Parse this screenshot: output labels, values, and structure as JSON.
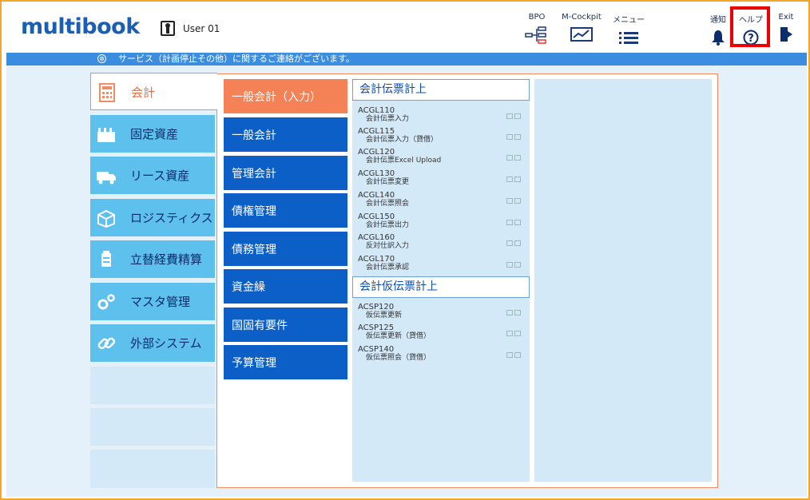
{
  "header": {
    "logo": "multibook",
    "user": "User 01",
    "nav": {
      "bpo": "BPO",
      "mcockpit": "M-Cockpit",
      "menu": "メニュー",
      "notify": "通知",
      "help": "ヘルプ",
      "exit": "Exit"
    }
  },
  "notice": {
    "icon": "⊗",
    "text": "サービス（計画停止その他）に関するご連絡がございます。"
  },
  "categories": [
    {
      "label": "会計",
      "icon": "calculator-icon"
    },
    {
      "label": "固定資産",
      "icon": "factory-icon"
    },
    {
      "label": "リース資産",
      "icon": "truck-icon"
    },
    {
      "label": "ロジスティクス",
      "icon": "box-icon"
    },
    {
      "label": "立替経費精算",
      "icon": "suitcase-icon"
    },
    {
      "label": "マスタ管理",
      "icon": "gears-icon"
    },
    {
      "label": "外部システム",
      "icon": "link-icon"
    }
  ],
  "subcategories": [
    {
      "label": "一般会計（入力）"
    },
    {
      "label": "一般会計"
    },
    {
      "label": "管理会計"
    },
    {
      "label": "債権管理"
    },
    {
      "label": "債務管理"
    },
    {
      "label": "資金繰"
    },
    {
      "label": "国固有要件"
    },
    {
      "label": "予算管理"
    }
  ],
  "sections": [
    {
      "title": "会計伝票計上",
      "items": [
        {
          "code": "ACGL110",
          "name": "会計伝票入力"
        },
        {
          "code": "ACGL115",
          "name": "会計伝票入力（貸借）"
        },
        {
          "code": "ACGL120",
          "name": "会計伝票Excel Upload"
        },
        {
          "code": "ACGL130",
          "name": "会計伝票変更"
        },
        {
          "code": "ACGL140",
          "name": "会計伝票照会"
        },
        {
          "code": "ACGL150",
          "name": "会計伝票出力"
        },
        {
          "code": "ACGL160",
          "name": "反対仕訳入力"
        },
        {
          "code": "ACGL170",
          "name": "会計伝票承認"
        }
      ]
    },
    {
      "title": "会計仮伝票計上",
      "items": [
        {
          "code": "ACSP120",
          "name": "仮伝票更新"
        },
        {
          "code": "ACSP125",
          "name": "仮伝票更新（貸借）"
        },
        {
          "code": "ACSP140",
          "name": "仮伝票照会（貸借）"
        }
      ]
    }
  ],
  "colors": {
    "brand": "#1a5fb4",
    "active_orange": "#f58156",
    "sub_blue": "#0d5fc8",
    "cat_cyan": "#5ec0ec",
    "highlight_red": "#ee0000"
  }
}
